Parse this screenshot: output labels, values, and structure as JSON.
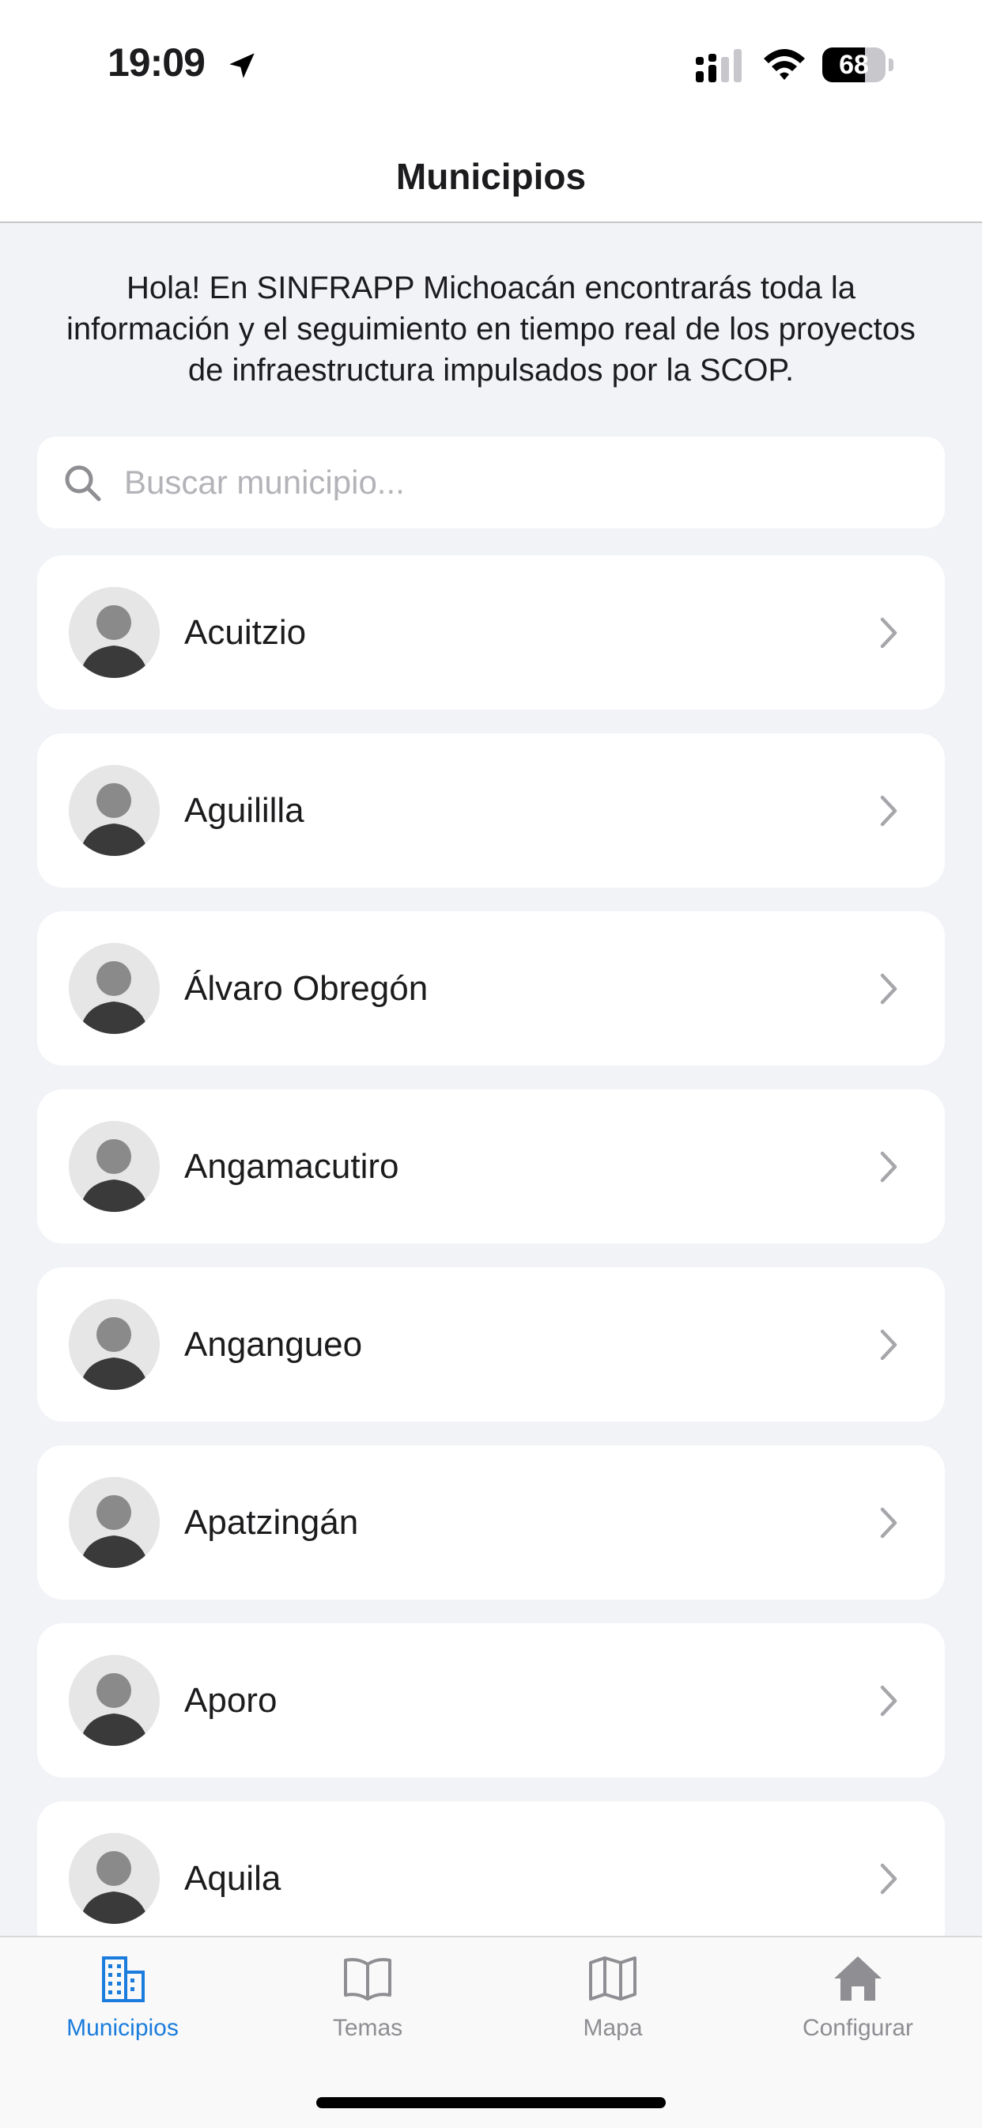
{
  "status_bar": {
    "time": "19:09",
    "battery_percent": "68",
    "battery_level": 0.68
  },
  "nav": {
    "title": "Municipios"
  },
  "intro_text": "Hola! En SINFRAPP Michoacán encontrarás toda la información y el seguimiento en tiempo real de los proyectos de infraestructura impulsados por la SCOP.",
  "search": {
    "placeholder": "Buscar municipio...",
    "value": ""
  },
  "municipalities": [
    {
      "name": "Acuitzio",
      "avatar": "portrait-photo"
    },
    {
      "name": "Aguililla",
      "avatar": "portrait-photo"
    },
    {
      "name": "Álvaro Obregón",
      "avatar": "portrait-photo"
    },
    {
      "name": "Angamacutiro",
      "avatar": "portrait-photo"
    },
    {
      "name": "Angangueo",
      "avatar": "portrait-photo"
    },
    {
      "name": "Apatzingán",
      "avatar": "portrait-photo"
    },
    {
      "name": "Aporo",
      "avatar": "portrait-photo"
    },
    {
      "name": "Aquila",
      "avatar": "portrait-photo"
    }
  ],
  "tabs": [
    {
      "label": "Municipios",
      "icon": "buildings-icon",
      "active": true
    },
    {
      "label": "Temas",
      "icon": "book-icon",
      "active": false
    },
    {
      "label": "Mapa",
      "icon": "map-icon",
      "active": false
    },
    {
      "label": "Configurar",
      "icon": "house-icon",
      "active": false
    }
  ],
  "colors": {
    "accent": "#1a7cdc",
    "inactive": "#8e8e93",
    "background": "#f2f3f7",
    "card": "#ffffff",
    "chevron": "#a7a7ab"
  }
}
